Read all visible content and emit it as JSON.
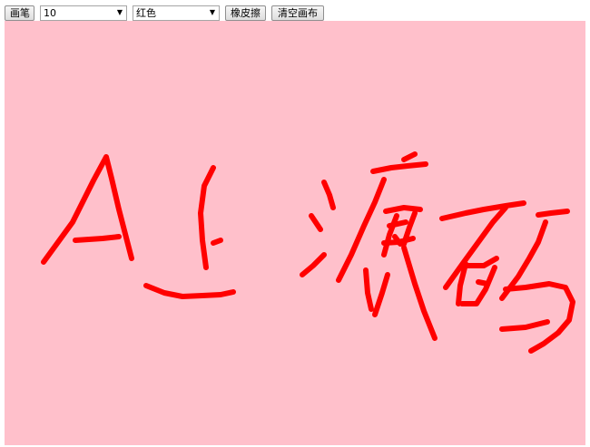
{
  "toolbar": {
    "brush_label": "画笔",
    "size_value": "10",
    "color_value": "红色",
    "eraser_label": "橡皮擦",
    "clear_label": "清空画布"
  },
  "canvas": {
    "background": "#ffc0cb",
    "stroke_color": "#ff0000",
    "stroke_width": 6
  },
  "icons": {
    "dropdown": "chevron-down-icon"
  }
}
